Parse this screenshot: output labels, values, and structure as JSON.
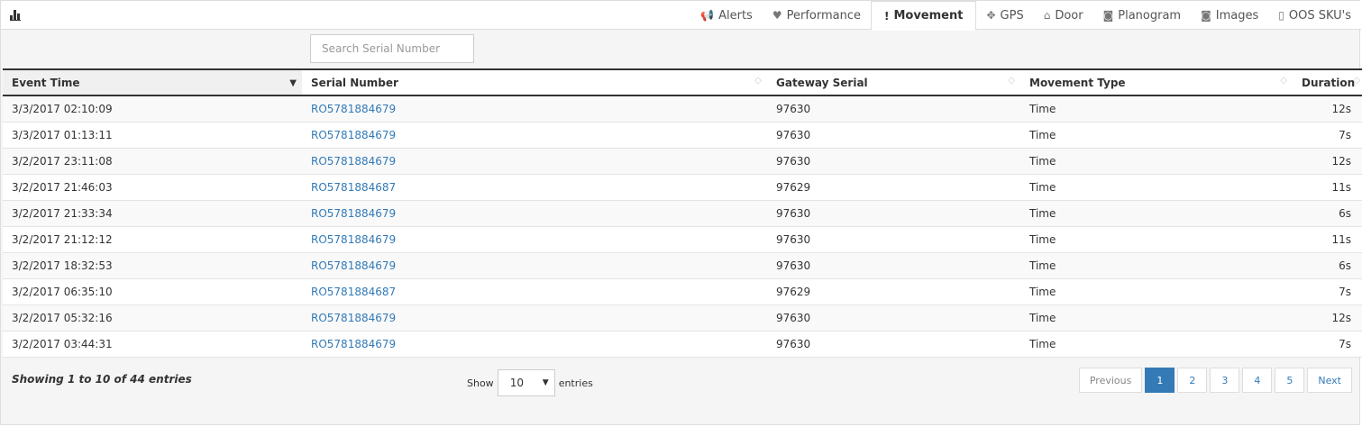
{
  "tabs": [
    {
      "icon": "megaphone-icon",
      "glyph": "📢",
      "label": "Alerts"
    },
    {
      "icon": "heart-icon",
      "glyph": "♥",
      "label": "Performance"
    },
    {
      "icon": "exclamation-icon",
      "glyph": "!",
      "label": "Movement",
      "active": true
    },
    {
      "icon": "move-arrows-icon",
      "glyph": "✥",
      "label": "GPS"
    },
    {
      "icon": "home-icon",
      "glyph": "⌂",
      "label": "Door"
    },
    {
      "icon": "camera-icon",
      "glyph": "◙",
      "label": "Planogram"
    },
    {
      "icon": "camera-icon",
      "glyph": "◙",
      "label": "Images"
    },
    {
      "icon": "phone-icon",
      "glyph": "▯",
      "label": "OOS SKU's"
    }
  ],
  "search": {
    "placeholder": "Search Serial Number",
    "value": ""
  },
  "table": {
    "columns": [
      "Event Time",
      "Serial Number",
      "Gateway Serial",
      "Movement Type",
      "Duration"
    ],
    "rows": [
      [
        "3/3/2017 02:10:09",
        "RO5781884679",
        "97630",
        "Time",
        "12s"
      ],
      [
        "3/3/2017 01:13:11",
        "RO5781884679",
        "97630",
        "Time",
        "7s"
      ],
      [
        "3/2/2017 23:11:08",
        "RO5781884679",
        "97630",
        "Time",
        "12s"
      ],
      [
        "3/2/2017 21:46:03",
        "RO5781884687",
        "97629",
        "Time",
        "11s"
      ],
      [
        "3/2/2017 21:33:34",
        "RO5781884679",
        "97630",
        "Time",
        "6s"
      ],
      [
        "3/2/2017 21:12:12",
        "RO5781884679",
        "97630",
        "Time",
        "11s"
      ],
      [
        "3/2/2017 18:32:53",
        "RO5781884679",
        "97630",
        "Time",
        "6s"
      ],
      [
        "3/2/2017 06:35:10",
        "RO5781884687",
        "97629",
        "Time",
        "7s"
      ],
      [
        "3/2/2017 05:32:16",
        "RO5781884679",
        "97630",
        "Time",
        "12s"
      ],
      [
        "3/2/2017 03:44:31",
        "RO5781884679",
        "97630",
        "Time",
        "7s"
      ]
    ]
  },
  "footer": {
    "info": "Showing 1 to 10 of 44 entries",
    "show_label": "Show",
    "entries_value": "10",
    "entries_label": "entries"
  },
  "pagination": {
    "previous": "Previous",
    "pages": [
      "1",
      "2",
      "3",
      "4",
      "5"
    ],
    "active_page": "1",
    "next": "Next"
  },
  "colors": {
    "link": "#337ab7",
    "active_page": "#337ab7"
  }
}
